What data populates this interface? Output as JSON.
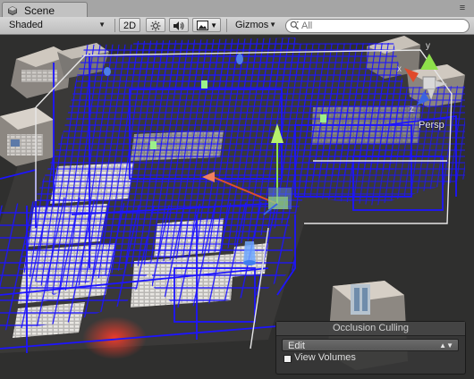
{
  "window": {
    "tab_label": "Scene"
  },
  "toolbar": {
    "shading_mode": "Shaded",
    "mode_2d": "2D",
    "gizmos_label": "Gizmos",
    "search_placeholder": "All"
  },
  "viewport": {
    "projection_label": "Persp"
  },
  "occlusion_panel": {
    "title": "Occlusion Culling",
    "mode_value": "Edit",
    "view_volumes_label": "View Volumes",
    "view_volumes_checked": true
  },
  "colors": {
    "cell_lines": "#1d14ff",
    "wall_lines": "#e6e6e6",
    "ground": "#2f2f2e"
  },
  "icons": [
    "scene-tab-icon",
    "scene-lighting-icon",
    "audio-icon",
    "effects-icon",
    "search-icon",
    "axis-gizmo-icon"
  ]
}
